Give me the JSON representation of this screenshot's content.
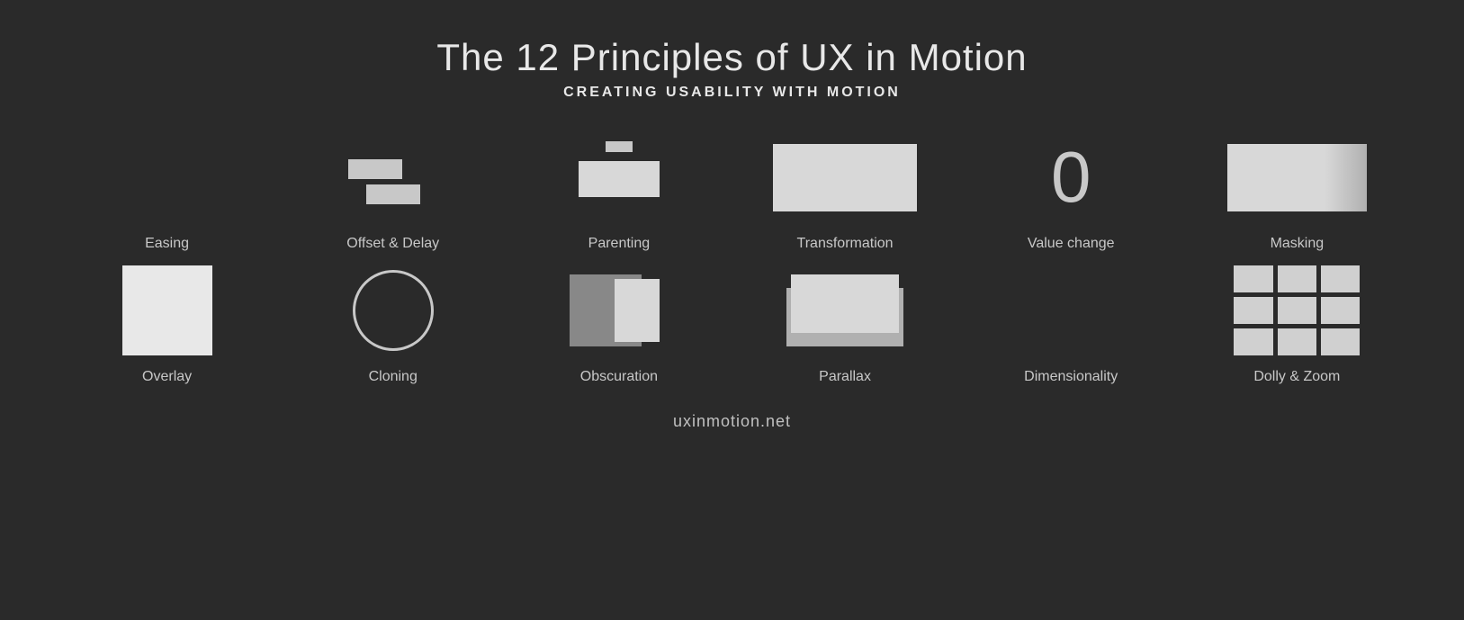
{
  "header": {
    "title": "The 12 Principles of UX in Motion",
    "subtitle": "CREATING USABILITY WITH MOTION"
  },
  "row1": [
    {
      "id": "easing",
      "label": "Easing"
    },
    {
      "id": "offset-delay",
      "label": "Offset & Delay"
    },
    {
      "id": "parenting",
      "label": "Parenting"
    },
    {
      "id": "transformation",
      "label": "Transformation"
    },
    {
      "id": "value-change",
      "label": "Value change"
    },
    {
      "id": "masking",
      "label": "Masking"
    }
  ],
  "row2": [
    {
      "id": "overlay",
      "label": "Overlay"
    },
    {
      "id": "cloning",
      "label": "Cloning"
    },
    {
      "id": "obscuration",
      "label": "Obscuration"
    },
    {
      "id": "parallax",
      "label": "Parallax"
    },
    {
      "id": "dimensionality",
      "label": "Dimensionality"
    },
    {
      "id": "dolly-zoom",
      "label": "Dolly & Zoom"
    }
  ],
  "value_change_symbol": "0",
  "footer": {
    "url": "uxinmotion.net"
  }
}
